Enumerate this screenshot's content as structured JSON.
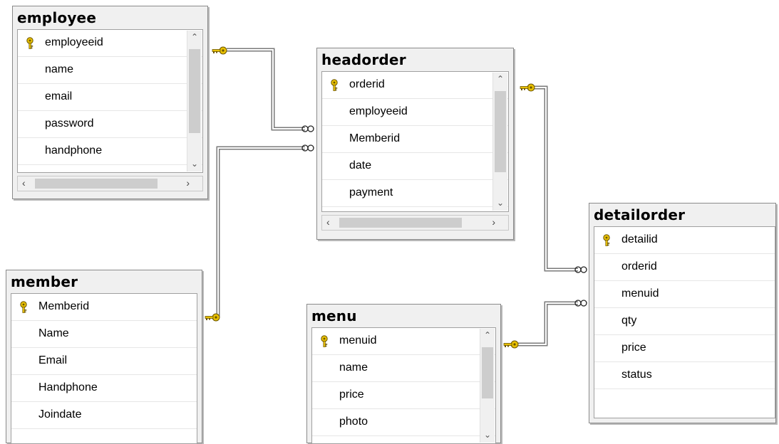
{
  "tables": {
    "employee": {
      "title": "employee",
      "columns": [
        {
          "name": "employeeid",
          "key": true
        },
        {
          "name": "name",
          "key": false
        },
        {
          "name": "email",
          "key": false
        },
        {
          "name": "password",
          "key": false
        },
        {
          "name": "handphone",
          "key": false
        }
      ]
    },
    "headorder": {
      "title": "headorder",
      "columns": [
        {
          "name": "orderid",
          "key": true
        },
        {
          "name": "employeeid",
          "key": false
        },
        {
          "name": "Memberid",
          "key": false
        },
        {
          "name": "date",
          "key": false
        },
        {
          "name": "payment",
          "key": false
        }
      ]
    },
    "detailorder": {
      "title": "detailorder",
      "columns": [
        {
          "name": "detailid",
          "key": true
        },
        {
          "name": "orderid",
          "key": false
        },
        {
          "name": "menuid",
          "key": false
        },
        {
          "name": "qty",
          "key": false
        },
        {
          "name": "price",
          "key": false
        },
        {
          "name": "status",
          "key": false
        }
      ]
    },
    "member": {
      "title": "member",
      "columns": [
        {
          "name": "Memberid",
          "key": true
        },
        {
          "name": "Name",
          "key": false
        },
        {
          "name": "Email",
          "key": false
        },
        {
          "name": "Handphone",
          "key": false
        },
        {
          "name": "Joindate",
          "key": false
        }
      ]
    },
    "menu": {
      "title": "menu",
      "columns": [
        {
          "name": "menuid",
          "key": true
        },
        {
          "name": "name",
          "key": false
        },
        {
          "name": "price",
          "key": false
        },
        {
          "name": "photo",
          "key": false
        }
      ]
    }
  },
  "relationships": [
    {
      "from": "employee.employeeid",
      "to": "headorder.employeeid"
    },
    {
      "from": "member.Memberid",
      "to": "headorder.Memberid"
    },
    {
      "from": "headorder.orderid",
      "to": "detailorder.orderid"
    },
    {
      "from": "menu.menuid",
      "to": "detailorder.menuid"
    }
  ],
  "colors": {
    "key_gold": "#e8c000",
    "line": "#7a7a7a",
    "header_bg": "#f0f0f0",
    "border": "#8a8a8a"
  },
  "icons": {
    "primary_key": "key-icon",
    "one_end": "key-icon",
    "many_end": "infinity-icon"
  }
}
